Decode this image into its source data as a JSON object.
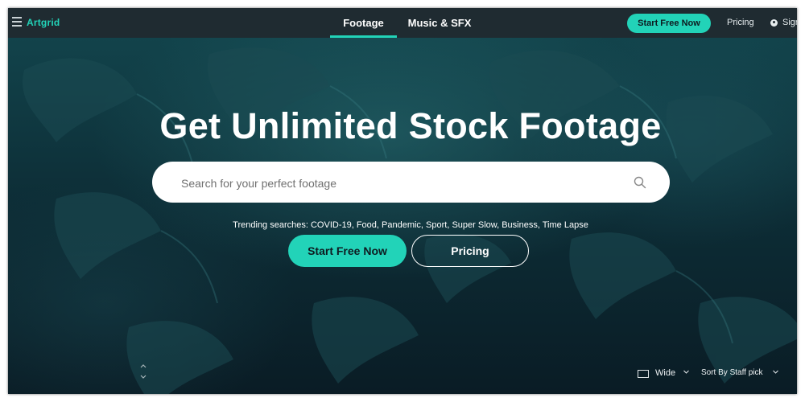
{
  "header": {
    "logo": "Artgrid",
    "tabs": [
      {
        "label": "Footage",
        "active": true
      },
      {
        "label": "Music & SFX",
        "active": false
      }
    ],
    "start_free_label": "Start Free Now",
    "pricing_label": "Pricing",
    "signin_label": "Sign",
    "menu_icon": "hamburger-menu-icon",
    "user_icon": "user-icon"
  },
  "hero": {
    "headline": "Get Unlimited Stock Footage",
    "search": {
      "placeholder": "Search for your perfect footage",
      "value": "",
      "icon": "search-icon"
    },
    "trending_text": "Trending searches: COVID-19, Food, Pandemic, Sport, Super Slow, Business, Time Lapse",
    "start_free_label": "Start Free Now",
    "pricing_label": "Pricing"
  },
  "view_controls": {
    "layout_label": "Wide",
    "sort_label": "Sort By Staff pick"
  },
  "colors": {
    "accent": "#22d3b8",
    "topbar": "#1f2b31",
    "hero_dark": "#0b1e27"
  }
}
